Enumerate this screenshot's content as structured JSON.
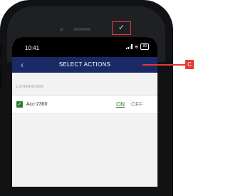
{
  "status_bar": {
    "time": "10:41",
    "battery": "80"
  },
  "app_bar": {
    "title": "SELECT ACTIONS",
    "back_icon": "chevron-left-icon",
    "confirm_icon": "checkmark-icon"
  },
  "section": {
    "label": "LIVINGROOM"
  },
  "devices": [
    {
      "name": "Acc-2360",
      "checked": true,
      "on_label": "ON",
      "off_label": "OFF",
      "selected": "ON"
    }
  ],
  "callout": {
    "label": "C"
  },
  "colors": {
    "app_bar": "#1a2a66",
    "accent_green": "#2e7d32",
    "callout_red": "#e53935"
  }
}
